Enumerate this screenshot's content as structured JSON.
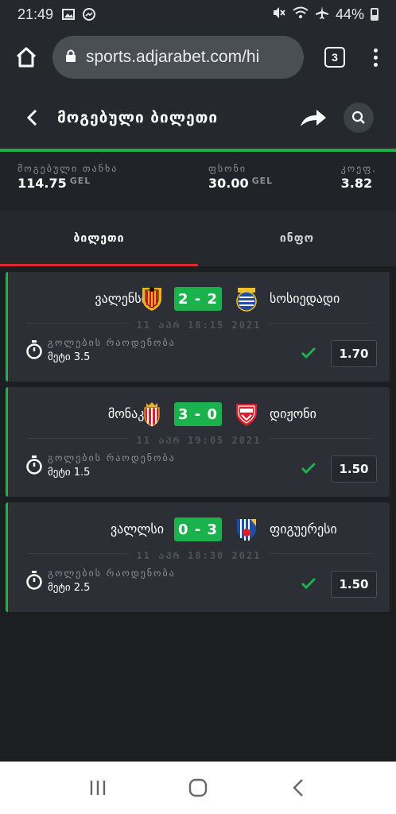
{
  "status_bar": {
    "time": "21:49",
    "battery": "44%",
    "icons": [
      "image-icon",
      "messenger-icon",
      "mute-icon",
      "wifi-icon",
      "airplane-icon",
      "battery-icon"
    ]
  },
  "browser": {
    "url": "sports.adjarabet.com/hi",
    "tab_count": "3"
  },
  "header": {
    "title": "მოგებული ბილეთი"
  },
  "summary": {
    "win_label": "მოგებული თანხა",
    "win_value": "114.75",
    "win_currency": "GEL",
    "stake_label": "ფსონი",
    "stake_value": "30.00",
    "stake_currency": "GEL",
    "coef_label": "კოეფ.",
    "coef_value": "3.82"
  },
  "tabs": [
    {
      "label": "ბილეთი",
      "active": true
    },
    {
      "label": "ინფო",
      "active": false
    }
  ],
  "bets": [
    {
      "home": "ვალენსია",
      "away": "სოსიედადი",
      "score": "2 - 2",
      "date": "11 აპრ 18:15 2021",
      "market": "გოლების რაოდენობა",
      "pick": "მეტი 3.5",
      "odds": "1.70",
      "home_logo": "valencia-logo-icon",
      "away_logo": "real-sociedad-logo-icon"
    },
    {
      "home": "მონაკო",
      "away": "დიჟონი",
      "score": "3 - 0",
      "date": "11 აპრ 19:05 2021",
      "market": "გოლების რაოდენობა",
      "pick": "მეტი 1.5",
      "odds": "1.50",
      "home_logo": "monaco-logo-icon",
      "away_logo": "dijon-logo-icon"
    },
    {
      "home": "ვალლსი",
      "away": "ფიგუერესი",
      "score": "0 - 3",
      "date": "11 აპრ 18:30 2021",
      "market": "გოლების რაოდენობა",
      "pick": "მეტი 2.5",
      "odds": "1.50",
      "home_logo": "",
      "away_logo": "figueres-logo-icon"
    }
  ],
  "colors": {
    "accent_green": "#1bb14c",
    "accent_red": "#e0262d",
    "background": "#25282d",
    "card": "#2c2f35"
  }
}
